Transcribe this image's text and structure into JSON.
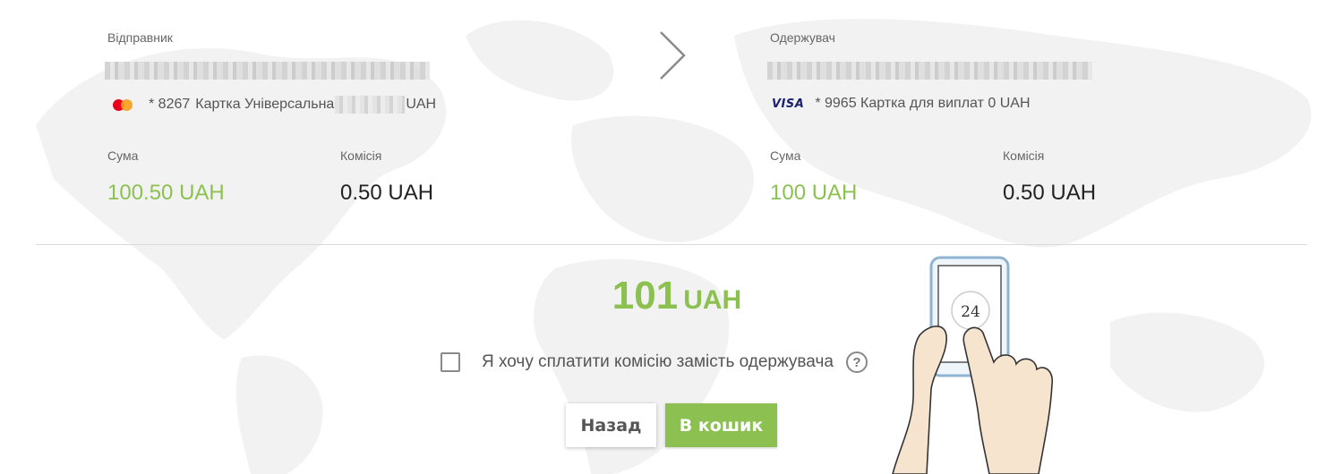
{
  "sender": {
    "label": "Відправник",
    "card_number": "* 8267",
    "card_name_prefix": "Картка Універсальна",
    "card_currency": "UAH",
    "card_brand_icon": "mastercard-icon",
    "amount_label": "Сума",
    "amount": "100.50 UAH",
    "fee_label": "Комісія",
    "fee": "0.50 UAH"
  },
  "recipient": {
    "label": "Одержувач",
    "card_brand": "VISA",
    "card_line": "* 9965 Картка для виплат 0 UAH",
    "amount_label": "Сума",
    "amount": "100 UAH",
    "fee_label": "Комісія",
    "fee": "0.50 UAH"
  },
  "total": {
    "value": "101",
    "currency": "UAH"
  },
  "pay_fee_checkbox": {
    "label": "Я хочу сплатити комісію замість одержувача",
    "checked": false,
    "help_icon": "?"
  },
  "buttons": {
    "back": "Назад",
    "cart": "В кошик"
  },
  "illustration": {
    "phone_badge": "24"
  },
  "colors": {
    "accent": "#8cc152",
    "text": "#222222",
    "muted": "#666666"
  }
}
